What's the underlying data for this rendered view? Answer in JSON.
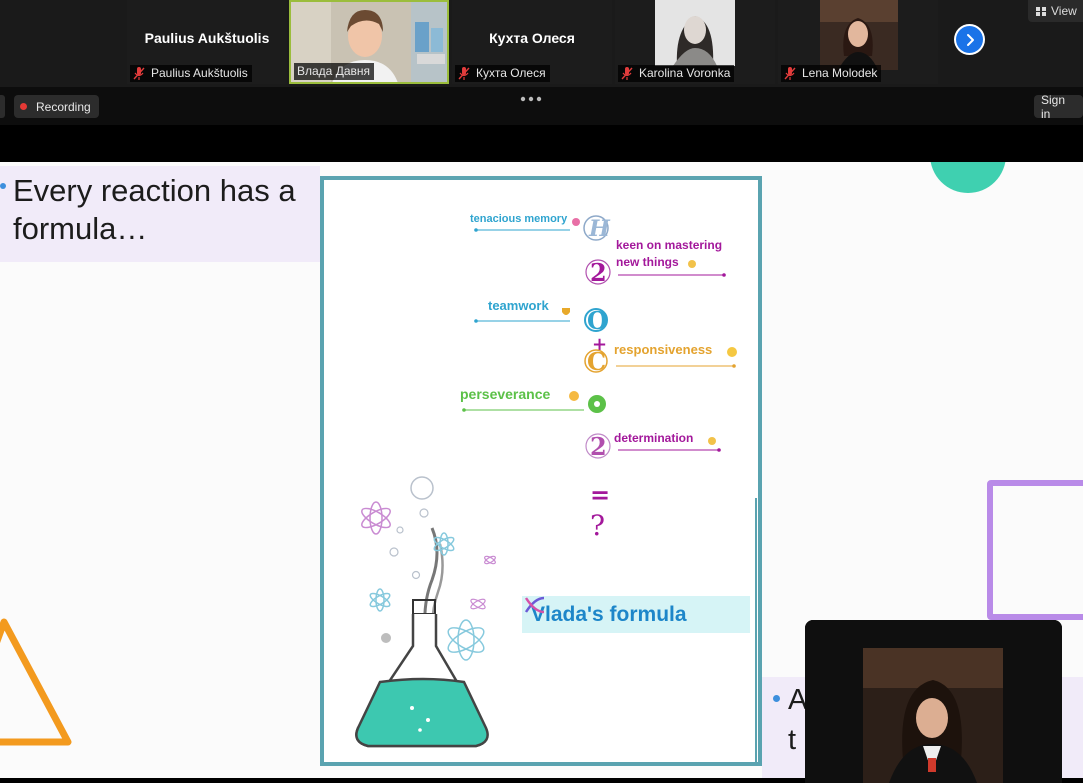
{
  "gallery": {
    "participants": [
      {
        "name": "Paulius Aukštuolis",
        "label": "Paulius Aukštuolis",
        "video": false
      },
      {
        "name": "Влада Давня",
        "label": "Влада Давня",
        "video": true,
        "active_speaker": true
      },
      {
        "name": "Кухта Олеся",
        "label": "Кухта Олеся",
        "video": false
      },
      {
        "name": "Karolina Voronka",
        "label": "Karolina Voronka",
        "video": true
      },
      {
        "name": "Lena Molodek",
        "label": "Lena Molodek",
        "video": true
      }
    ],
    "next_icon": "chevron-right-icon",
    "view_label": "View"
  },
  "toolbar": {
    "recording_label": "Recording",
    "signin_label": "Sign in",
    "more_icon": "more-horizontal-icon"
  },
  "slide": {
    "heading": "Every reaction has a formula…",
    "poster": {
      "traits": [
        "tenacious memory",
        "keen on mastering new things",
        "teamwork",
        "responsiveness",
        "perseverance",
        "determination"
      ],
      "title": "Vlada's formula",
      "symbols": [
        "H",
        "2",
        "O",
        "+",
        "C",
        "•",
        "2",
        "=",
        "?"
      ]
    },
    "right_text": "A t"
  },
  "colors": {
    "accent_blue": "#1a73e8",
    "recording_red": "#e53935",
    "poster_border": "#5aa3b0",
    "teal": "#3fd0b0",
    "lavender": "#f1ebf9",
    "purple_frame": "#b98be8",
    "orange_triangle": "#f39a1e",
    "trait_teal": "#2fa4cf",
    "trait_purple": "#a3189b",
    "trait_orange": "#e4a32f",
    "trait_green": "#5cc148"
  }
}
